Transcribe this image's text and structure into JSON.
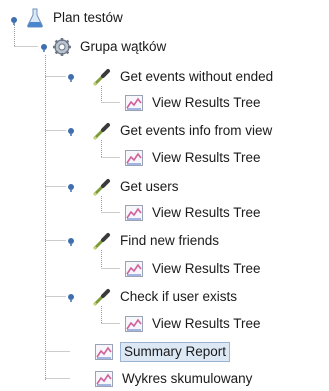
{
  "tree": {
    "root": {
      "label": "Plan testów",
      "icon": "flask-icon"
    },
    "group": {
      "label": "Grupa wątków",
      "icon": "gear-icon"
    },
    "samplers": [
      {
        "label": "Get events without ended",
        "icon": "pipette-icon",
        "listener": "View Results Tree"
      },
      {
        "label": "Get events info from view",
        "icon": "pipette-icon",
        "listener": "View Results Tree"
      },
      {
        "label": "Get users",
        "icon": "pipette-icon",
        "listener": "View Results Tree"
      },
      {
        "label": "Find new friends",
        "icon": "pipette-icon",
        "listener": "View Results Tree"
      },
      {
        "label": "Check if user exists",
        "icon": "pipette-icon",
        "listener": "View Results Tree"
      }
    ],
    "reports": [
      {
        "label": "Summary Report",
        "icon": "graph-icon",
        "selected": true
      },
      {
        "label": "Wykres skumulowany",
        "icon": "graph-icon",
        "selected": false
      }
    ]
  },
  "colors": {
    "connector": "#8a8a8a",
    "toggle": "#3f6fae",
    "selection_bg": "#dde8f5",
    "selection_border": "#9bb3d4"
  }
}
